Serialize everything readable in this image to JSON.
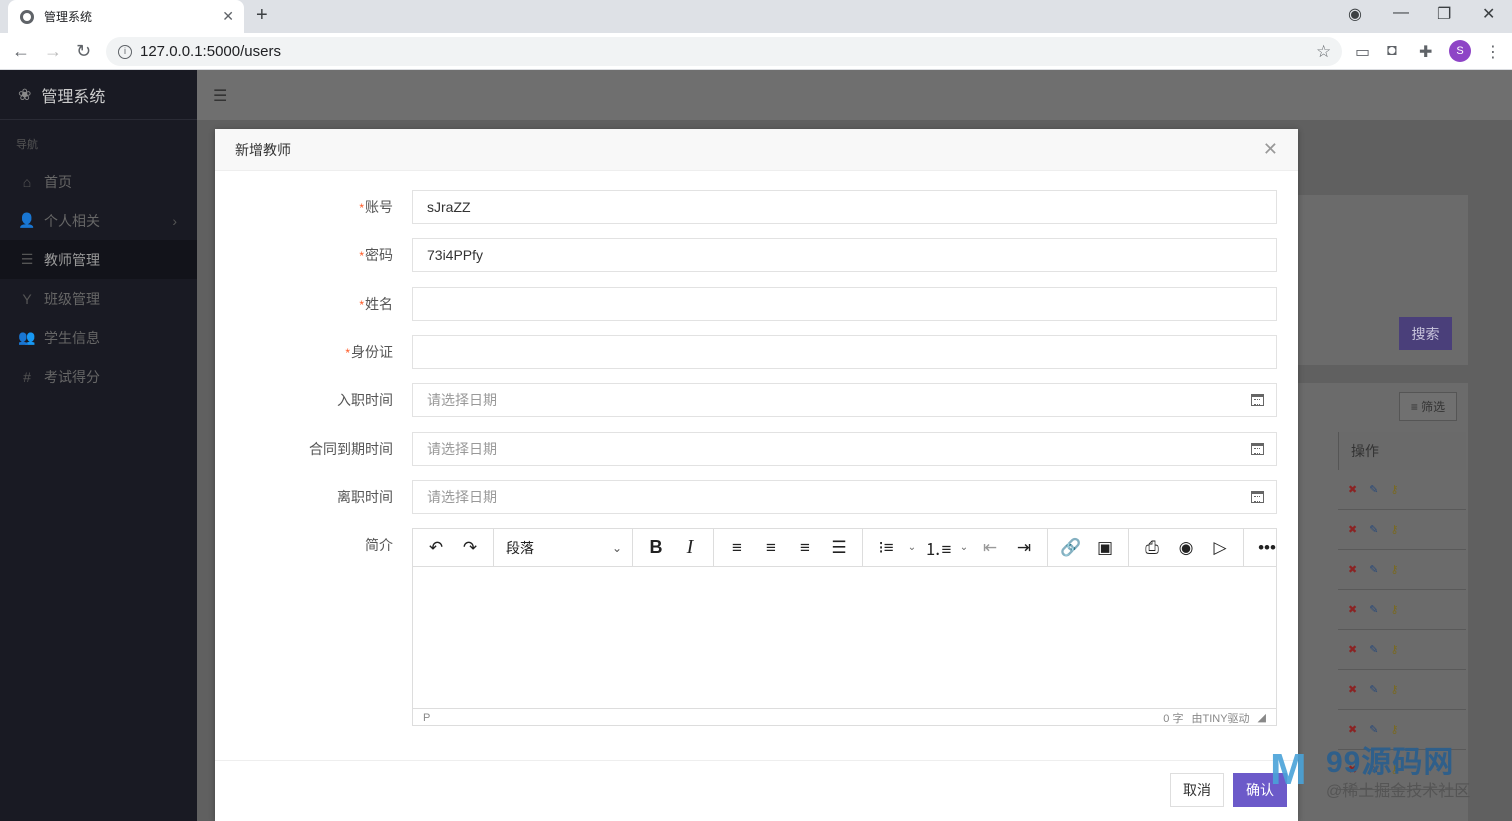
{
  "browser": {
    "tab_title": "管理系统",
    "tab_close": "✕",
    "new_tab": "+",
    "url": "127.0.0.1:5000/users",
    "profile_initial": "S"
  },
  "sidebar": {
    "brand": "管理系统",
    "section_label": "导航",
    "items": [
      {
        "label": "首页",
        "icon": "home-icon",
        "glyph": "⌂"
      },
      {
        "label": "个人相关",
        "icon": "user-icon",
        "glyph": "👤"
      },
      {
        "label": "教师管理",
        "icon": "list-icon",
        "glyph": "☰"
      },
      {
        "label": "班级管理",
        "icon": "filter-icon",
        "glyph": "Y"
      },
      {
        "label": "学生信息",
        "icon": "users-icon",
        "glyph": "👥"
      },
      {
        "label": "考试得分",
        "icon": "hash-icon",
        "glyph": "#"
      }
    ]
  },
  "background": {
    "search_button": "搜索",
    "filter_button": "筛选",
    "operations_header": "操作"
  },
  "modal": {
    "title": "新增教师",
    "close": "✕",
    "fields": [
      {
        "label": "账号",
        "required": true,
        "value": "sJraZZ",
        "placeholder": ""
      },
      {
        "label": "密码",
        "required": true,
        "value": "73i4PPfy",
        "placeholder": ""
      },
      {
        "label": "姓名",
        "required": true,
        "value": "",
        "placeholder": ""
      },
      {
        "label": "身份证",
        "required": true,
        "value": "",
        "placeholder": ""
      },
      {
        "label": "入职时间",
        "required": false,
        "value": "",
        "placeholder": "请选择日期"
      },
      {
        "label": "合同到期时间",
        "required": false,
        "value": "",
        "placeholder": "请选择日期"
      },
      {
        "label": "离职时间",
        "required": false,
        "value": "",
        "placeholder": "请选择日期"
      }
    ],
    "editor": {
      "label": "简介",
      "block_format": "段落",
      "status_path": "P",
      "word_count": "0 字",
      "powered_by": "由TINY驱动"
    },
    "cancel_label": "取消",
    "confirm_label": "确认"
  },
  "watermark": {
    "title": "99源码网",
    "subtitle": "@稀土掘金技术社区"
  }
}
